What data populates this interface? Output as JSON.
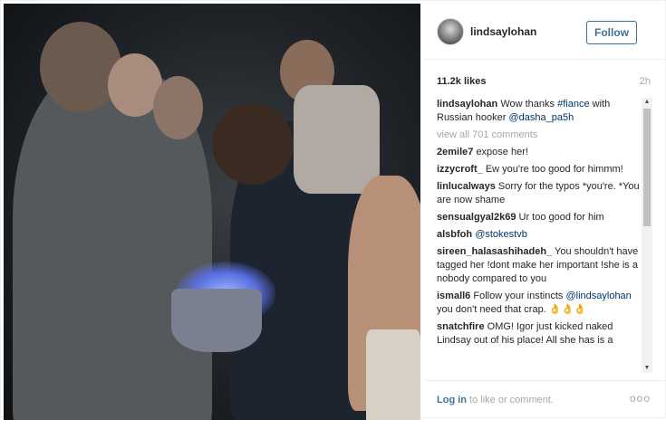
{
  "post": {
    "username": "lindsaylohan",
    "follow_label": "Follow",
    "likes": "11.2k likes",
    "time": "2h"
  },
  "icons": {
    "avatar": "profile-photo",
    "more": "ellipsis-icon"
  },
  "comments": [
    {
      "user": "lindsaylohan",
      "text": "Wow thanks ",
      "tag1": "#fiance",
      "text2": " with Russian hooker ",
      "tag2": "@dasha_pa5h"
    },
    {
      "view_all": "view all 701 comments"
    },
    {
      "user": "2emile7",
      "text": "expose her!"
    },
    {
      "user": "izzycroft_",
      "text": "Ew you're too good for himmm!"
    },
    {
      "user": "linlucalways",
      "text": "Sorry for the typos *you're. *You are now shame"
    },
    {
      "user": "sensualgyal2k69",
      "text": "Ur too good for him"
    },
    {
      "user": "alsbfoh",
      "tag": "@stokestvb"
    },
    {
      "user": "sireen_halasashihadeh_",
      "text": "You shouldn't have tagged her !dont make her important !she is a nobody compared to you"
    },
    {
      "user": "ismall6",
      "text": "Follow your instincts ",
      "tag": "@lindsaylohan",
      "text2": " you don't need that crap. 👌👌👌"
    },
    {
      "user": "snatchfire",
      "text": "OMG! Igor just kicked naked Lindsay out of his place! All she has is a"
    }
  ],
  "footer": {
    "login_link": "Log in",
    "login_text": " to like or comment.",
    "more_label": "ooo"
  },
  "colors": {
    "link": "#3f729b",
    "tag": "#003569",
    "muted": "#a5a7aa"
  }
}
